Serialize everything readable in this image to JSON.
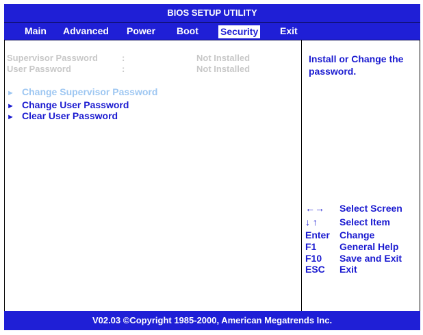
{
  "title": "BIOS SETUP UTILITY",
  "menu": [
    "Main",
    "Advanced",
    "Power",
    "Boot",
    "Security",
    "Exit"
  ],
  "active_menu": "Security",
  "fields": [
    {
      "label": "Supervisor Password",
      "sep": ":",
      "value": "Not Installed"
    },
    {
      "label": "User Password",
      "sep": ":",
      "value": "Not Installed"
    }
  ],
  "options": [
    {
      "label": "Change Supervisor Password",
      "state": "disabled"
    },
    {
      "label": "Change User Password",
      "state": "enabled"
    },
    {
      "label": "Clear User Password",
      "state": "enabled"
    }
  ],
  "arrow_glyph": "►",
  "help": "Install or Change the password.",
  "keys": [
    {
      "key": "←→",
      "desc": "Select Screen"
    },
    {
      "key": "↓ ↑",
      "desc": "Select Item"
    },
    {
      "key": "Enter",
      "desc": "Change"
    },
    {
      "key": "F1",
      "desc": "General Help"
    },
    {
      "key": "F10",
      "desc": "Save and Exit"
    },
    {
      "key": "ESC",
      "desc": "Exit"
    }
  ],
  "footer": "V02.03 ©Copyright 1985-2000, American Megatrends Inc.",
  "colors": {
    "bar_blue": "#1f1fd6",
    "text_blue": "#1a1ad0",
    "disabled_option": "#9ec7f2",
    "disabled_field": "#c8c8c8"
  }
}
